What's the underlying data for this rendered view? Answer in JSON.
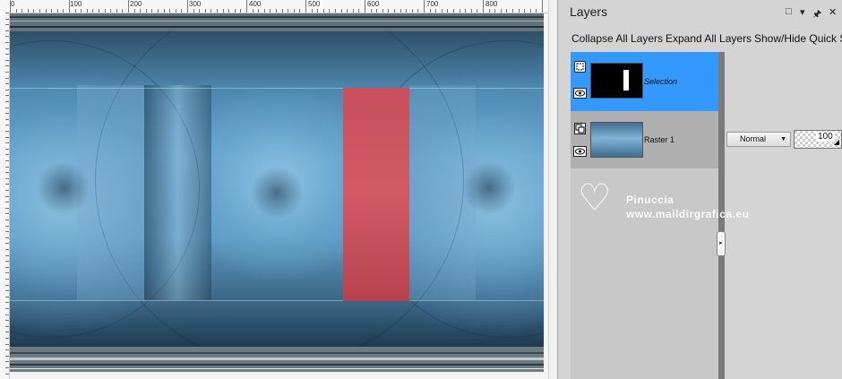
{
  "ruler": {
    "labels": [
      "0",
      "100",
      "200",
      "300",
      "400",
      "500",
      "600",
      "700",
      "800"
    ]
  },
  "panel": {
    "title": "Layers",
    "buttons": {
      "restore": "□",
      "menu": "▾",
      "pin": "🖈",
      "close": "✕"
    },
    "toolbar": {
      "collapse": "Collapse All Layers",
      "expand": "Expand All Layers",
      "quick": "Show/Hide Quick S"
    }
  },
  "layers": [
    {
      "name": "Selection",
      "selected": true
    },
    {
      "name": "Raster 1",
      "selected": false
    }
  ],
  "properties": {
    "blend_mode": "Normal",
    "opacity": "100"
  },
  "watermark": {
    "name": "Pinuccia",
    "site": "www.maildirgrafica.eu"
  },
  "colors": {
    "selection_accent": "#3399ff",
    "red_selection": "#c9505c",
    "canvas_blue": "#4b84a8"
  }
}
